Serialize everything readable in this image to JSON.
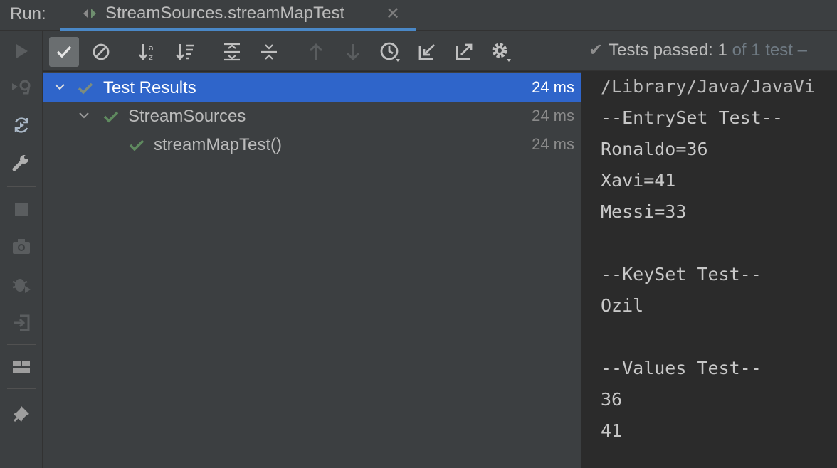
{
  "titlebar": {
    "run_label": "Run:",
    "tab_title": "StreamSources.streamMapTest",
    "close_glyph": "✕"
  },
  "toolbar": {
    "status_check": "✔",
    "status_label": "Tests passed:",
    "status_count": "1",
    "status_rest": "of 1 test –",
    "icons": [
      "show-passed-icon",
      "show-ignored-icon",
      "sort-alphabetically-icon",
      "sort-by-duration-icon",
      "expand-all-icon",
      "collapse-all-icon",
      "previous-failed-icon",
      "next-failed-icon",
      "test-history-icon",
      "import-tests-icon",
      "export-tests-icon",
      "settings-icon"
    ]
  },
  "sidebar": {
    "icons": [
      "rerun-icon",
      "rerun-failed-icon",
      "toggle-auto-test-icon",
      "wrench-icon",
      "stop-icon",
      "camera-icon",
      "debug-icon",
      "exit-icon",
      "layout-icon",
      "pin-icon"
    ]
  },
  "tree": {
    "rows": [
      {
        "name": "Test Results",
        "time": "24 ms"
      },
      {
        "name": "StreamSources",
        "time": "24 ms"
      },
      {
        "name": "streamMapTest()",
        "time": "24 ms"
      }
    ]
  },
  "console": {
    "lines": [
      "/Library/Java/JavaVi",
      "--EntrySet Test--",
      "Ronaldo=36",
      "Xavi=41",
      "Messi=33",
      "",
      "--KeySet Test--",
      "Ozil",
      "",
      "--Values Test--",
      "36",
      "41"
    ]
  },
  "colors": {
    "accent": "#4a88c7",
    "selection": "#2f65ca",
    "pass_check": "#5f8a5f"
  }
}
